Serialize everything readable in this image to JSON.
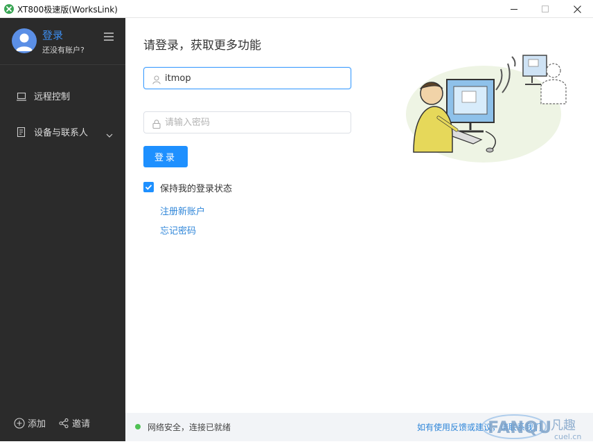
{
  "window": {
    "title": "XT800极速版(WorksLink)",
    "controls": [
      "minimize-icon",
      "maximize-icon",
      "close-icon"
    ]
  },
  "sidebar": {
    "login_label": "登录",
    "no_account_label": "还没有账户?",
    "items": [
      {
        "label": "远程控制",
        "icon": "monitor-icon"
      },
      {
        "label": "设备与联系人",
        "icon": "contacts-icon",
        "expandable": true
      }
    ],
    "bottom": {
      "add_label": "添加",
      "invite_label": "邀请"
    }
  },
  "main": {
    "heading": "请登录，获取更多功能",
    "username": {
      "value": "itmop",
      "icon": "user-icon"
    },
    "password": {
      "value": "",
      "placeholder": "请输入密码",
      "icon": "lock-icon"
    },
    "login_button": "登录",
    "remember": {
      "label": "保持我的登录状态",
      "checked": true
    },
    "register_link": "注册新账户",
    "forgot_link": "忘记密码"
  },
  "statusbar": {
    "status_text": "网络安全，连接已就绪",
    "feedback_text": "如有使用反馈或建议，请联系我们"
  },
  "watermark": {
    "text_en": "FANQU",
    "text_cn": "凡趣",
    "domain": "cuel.cn"
  },
  "colors": {
    "sidebar_bg": "#2b2b2b",
    "accent": "#1e90ff",
    "link": "#2f86d9",
    "status_ok": "#4fc154"
  }
}
